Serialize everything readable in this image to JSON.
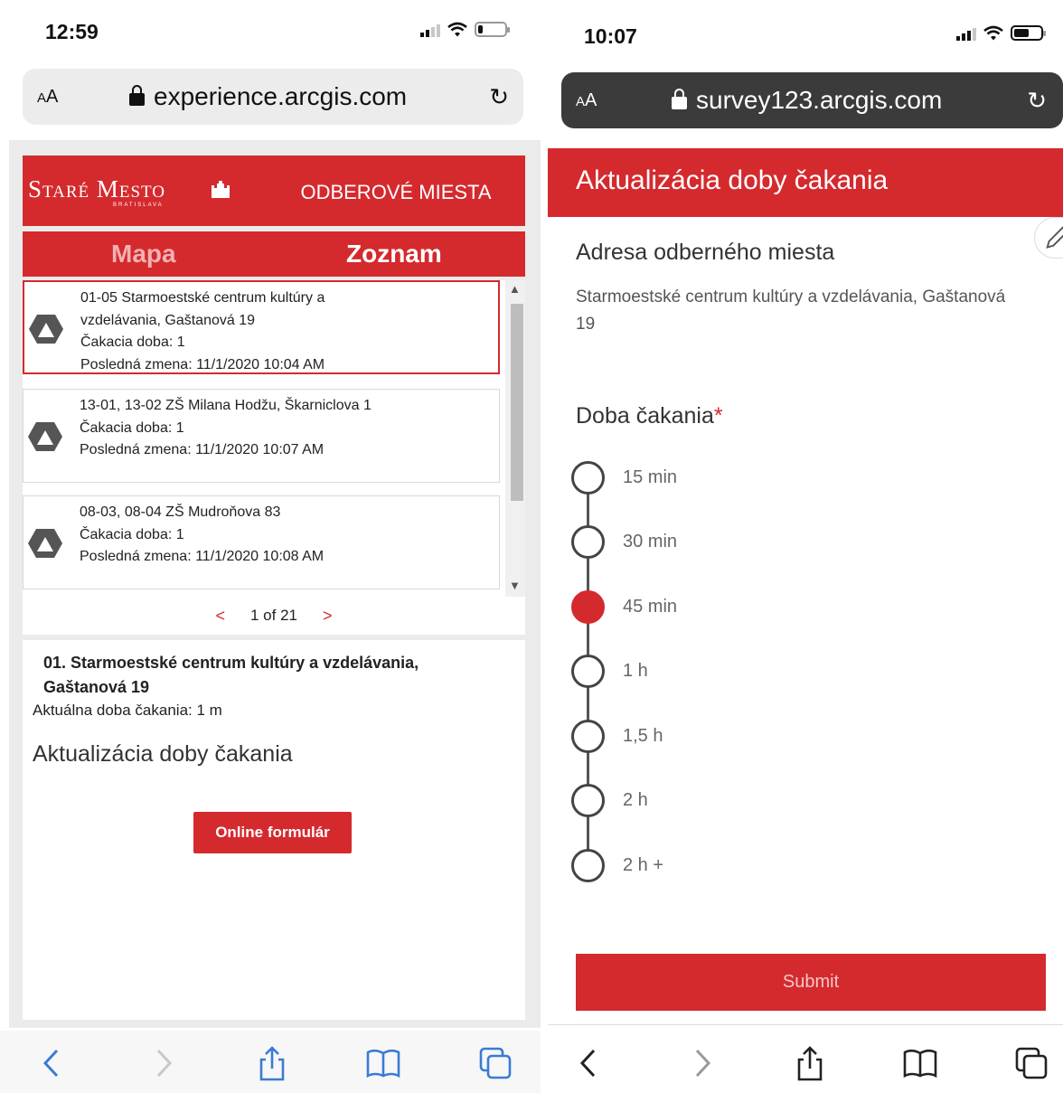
{
  "left": {
    "time": "12:59",
    "url": {
      "aa_small": "A",
      "aa_large": "A",
      "domain": "experience.arcgis.com",
      "reload": "↻"
    },
    "brand": {
      "name": "Staré Mesto",
      "sub": "BRATISLAVA",
      "icon": "castle-icon",
      "section": "ODBEROVÉ MIESTA"
    },
    "tabs": [
      {
        "label": "Mapa"
      },
      {
        "label": "Zoznam"
      }
    ],
    "items": [
      {
        "lines": [
          "01-05 Starmoestské centrum kultúry a",
          "vzdelávania, Gaštanová 19",
          "Čakacia doba: 1",
          "Posledná zmena: 11/1/2020 10:04 AM"
        ]
      },
      {
        "lines": [
          "13-01, 13-02 ZŠ Milana Hodžu, Škarniclova 1",
          "Čakacia doba: 1",
          "Posledná zmena: 11/1/2020 10:07 AM"
        ]
      },
      {
        "lines": [
          "08-03, 08-04 ZŠ Mudroňova 83",
          "Čakacia doba: 1",
          "Posledná zmena: 11/1/2020 10:08 AM"
        ]
      }
    ],
    "pager": {
      "prev": "<",
      "text": "1 of 21",
      "next": ">"
    },
    "detail": {
      "title": "01. Starmoestské centrum kultúry a vzdelávania, Gaštanová 19",
      "wait": "Aktuálna doba čakania: 1 m",
      "heading": "Aktualizácia doby čakania",
      "button": "Online formulár"
    }
  },
  "right": {
    "time": "10:07",
    "url": {
      "aa_small": "A",
      "aa_large": "A",
      "domain": "survey123.arcgis.com",
      "reload": "↻"
    },
    "header": "Aktualizácia doby čakania",
    "address_label": "Adresa odberného miesta",
    "address_value": "Starmoestské centrum kultúry a vzdelávania, Gaštanová 19",
    "wait_label": "Doba čakania",
    "required_mark": "*",
    "options": [
      {
        "label": "15 min",
        "checked": false
      },
      {
        "label": "30 min",
        "checked": false
      },
      {
        "label": "45 min",
        "checked": true
      },
      {
        "label": "1 h",
        "checked": false
      },
      {
        "label": "1,5 h",
        "checked": false
      },
      {
        "label": "2 h",
        "checked": false
      },
      {
        "label": "2 h +",
        "checked": false
      }
    ],
    "submit": "Submit"
  },
  "colors": {
    "accent": "#d42a2e",
    "toolbar_left": "#3a7bd5",
    "toolbar_right": "#222222"
  }
}
